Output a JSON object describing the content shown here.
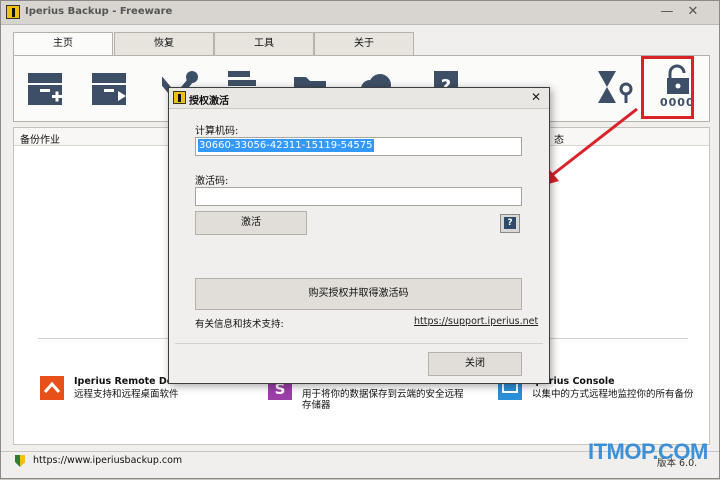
{
  "window": {
    "title": "Iperius Backup - Freeware",
    "minimize": "—",
    "close": "✕"
  },
  "tabs": [
    {
      "label": "主页"
    },
    {
      "label": "恢复"
    },
    {
      "label": "工具"
    },
    {
      "label": "关于"
    }
  ],
  "ribbon": {
    "icons": [
      "new-backup-icon",
      "run-backup-icon",
      "tools-icon",
      "list-icon",
      "folder-icon",
      "cloud-icon",
      "help-shield-icon",
      "hourglass-key-icon",
      "unlock-icon"
    ],
    "unlock_code": "0000"
  },
  "panels": {
    "left_header": "备份作业",
    "right_header": "态"
  },
  "promos": [
    {
      "title": "Iperius Remote De",
      "desc": "远程支持和远程桌面软件",
      "icon": "remote-desktop-icon",
      "color": "#e8501a"
    },
    {
      "title": "",
      "desc": "用于将你的数据保存到云端的安全远程存储器",
      "icon": "cloud-storage-icon",
      "color": "#9b3ea8"
    },
    {
      "title": "Iperius Console",
      "desc": "以集中的方式远程地监控你的所有备份",
      "icon": "console-icon",
      "color": "#2a8fd8"
    }
  ],
  "status": {
    "url": "https://www.iperiusbackup.com",
    "version": "版本 6.0."
  },
  "dialog": {
    "title": "授权激活",
    "close": "✕",
    "machine_code_label": "计算机码:",
    "machine_code_value": "30660-33056-42311-15119-54575",
    "activation_code_label": "激活码:",
    "activation_code_value": "",
    "activate_button": "激活",
    "help_button": "?",
    "buy_button": "购买授权并取得激活码",
    "info_label": "有关信息和技术支持:",
    "info_link": "https://support.iperius.net",
    "close_button": "关闭"
  },
  "watermark": "ITMOP.COM",
  "colors": {
    "highlight_box": "#d9232a",
    "arrow": "#d9232a",
    "selection": "#3399ff",
    "watermark": "#2a87d6"
  }
}
